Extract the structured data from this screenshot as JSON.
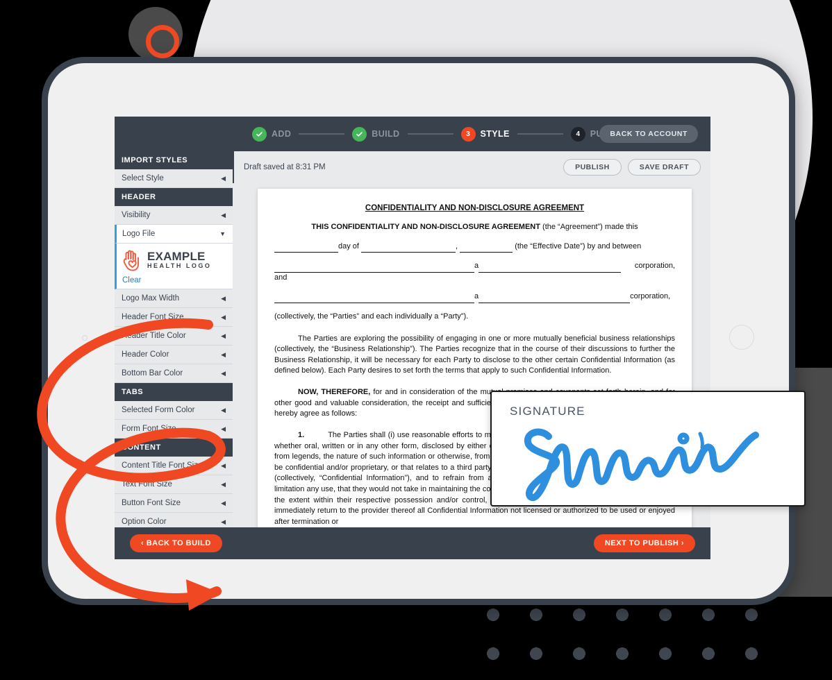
{
  "stepper": {
    "steps": [
      {
        "label": "ADD",
        "state": "done",
        "num": "1",
        "glyph": "check-icon"
      },
      {
        "label": "BUILD",
        "state": "done",
        "num": "2",
        "glyph": "check-icon"
      },
      {
        "label": "STYLE",
        "state": "current",
        "num": "3",
        "glyph": "3"
      },
      {
        "label": "PUBLISH",
        "state": "todo",
        "num": "4",
        "glyph": "4"
      }
    ],
    "back_to_account": "BACK TO ACCOUNT"
  },
  "sidebar": {
    "sections": [
      {
        "header": "IMPORT STYLES",
        "items": [
          {
            "label": "Select Style",
            "control": "arrow-left"
          }
        ]
      },
      {
        "header": "HEADER",
        "items": [
          {
            "label": "Visibility",
            "control": "arrow-left"
          },
          {
            "label": "Logo File",
            "control": "caret-down",
            "selected": true
          },
          {
            "label": "Logo Max Width",
            "control": "arrow-left"
          },
          {
            "label": "Header Font Size",
            "control": "arrow-left"
          },
          {
            "label": "Header Title Color",
            "control": "arrow-left"
          },
          {
            "label": "Header Color",
            "control": "arrow-left"
          },
          {
            "label": "Bottom Bar Color",
            "control": "arrow-left"
          }
        ]
      },
      {
        "header": "TABS",
        "items": [
          {
            "label": "Selected Form Color",
            "control": "arrow-left"
          },
          {
            "label": "Form Font Size",
            "control": "arrow-left"
          }
        ]
      },
      {
        "header": "CONTENT",
        "items": [
          {
            "label": "Content Title Font Size",
            "control": "arrow-left"
          },
          {
            "label": "Text Font Size",
            "control": "arrow-left"
          },
          {
            "label": "Button Font Size",
            "control": "arrow-left"
          },
          {
            "label": "Option Color",
            "control": "arrow-left"
          }
        ]
      }
    ],
    "logo": {
      "line1": "EXAMPLE",
      "line2": "HEALTH LOGO",
      "clear_label": "Clear",
      "icon": "hand-heart-icon"
    }
  },
  "doc_toolbar": {
    "draft_status": "Draft saved at 8:31 PM",
    "publish": "PUBLISH",
    "save_draft": "SAVE DRAFT"
  },
  "document": {
    "title": "CONFIDENTIALITY AND NON-DISCLOSURE AGREEMENT",
    "intro_bold": "THIS CONFIDENTIALITY AND NON-DISCLOSURE AGREEMENT",
    "intro_rest": " (the “Agreement”) made  this",
    "line_day": "day of ",
    "line_effective": " (the “Effective Date”) by and between",
    "line_corp_and": " corporation, and",
    "line_corp": "corporation,",
    "line_a": "a",
    "line_parties": "(collectively, the “Parties” and each individually a “Party”).",
    "para1": "The Parties are exploring the possibility of engaging in one or more mutually beneficial business relationships (collectively, the “Business Relationship”).  The Parties recognize that in the course of their discussions to further the Business Relationship, it will be necessary for each Party to disclose to the other certain Confidential Information (as defined below). Each Party desires to set forth the terms that apply to such Confidential Information.",
    "para2_bold": "NOW, THEREFORE,",
    "para2": " for and in consideration of the mutual promises and covenants set forth herein, and for other good and valuable consideration, the receipt and sufficiency of which is hereby acknowledged, the Parties do hereby agree as follows:",
    "para3_num": "1.",
    "para3": "The Parties shall (i) use reasonable efforts to maintain the confidentiality of information and materials, whether oral, written or in any other form, disclosed by either of them that is designated, or reasonably understood, from legends, the nature of such information or otherwise, from the circumstances of such information’s disclosure, to be confidential and/or proprietary, or that relates to a third party to which either of them owes a duty of nondisclosure (collectively, “Confidential Information”), and to refrain from any action in connection therewith, including without limitation any use, that they would not take in maintaining the confidentiality of its comparable proprietary assets; (iii) to the extent within their respective possession and/or control,  upon termination of this Agreement for any reason, immediately return to the provider thereof all Confidential Information not licensed or authorized to be used or enjoyed after termination or"
  },
  "bottom_nav": {
    "back": "‹ BACK TO BUILD",
    "next": "NEXT TO PUBLISH ›"
  },
  "signature_card": {
    "label": "SIGNATURE",
    "signature_name": "Michelle",
    "ink_color": "#2d8fdd"
  },
  "colors": {
    "accent_orange": "#ef4823",
    "dark_navy": "#39414d",
    "green": "#46b758",
    "blue_link": "#2f7fc1"
  }
}
